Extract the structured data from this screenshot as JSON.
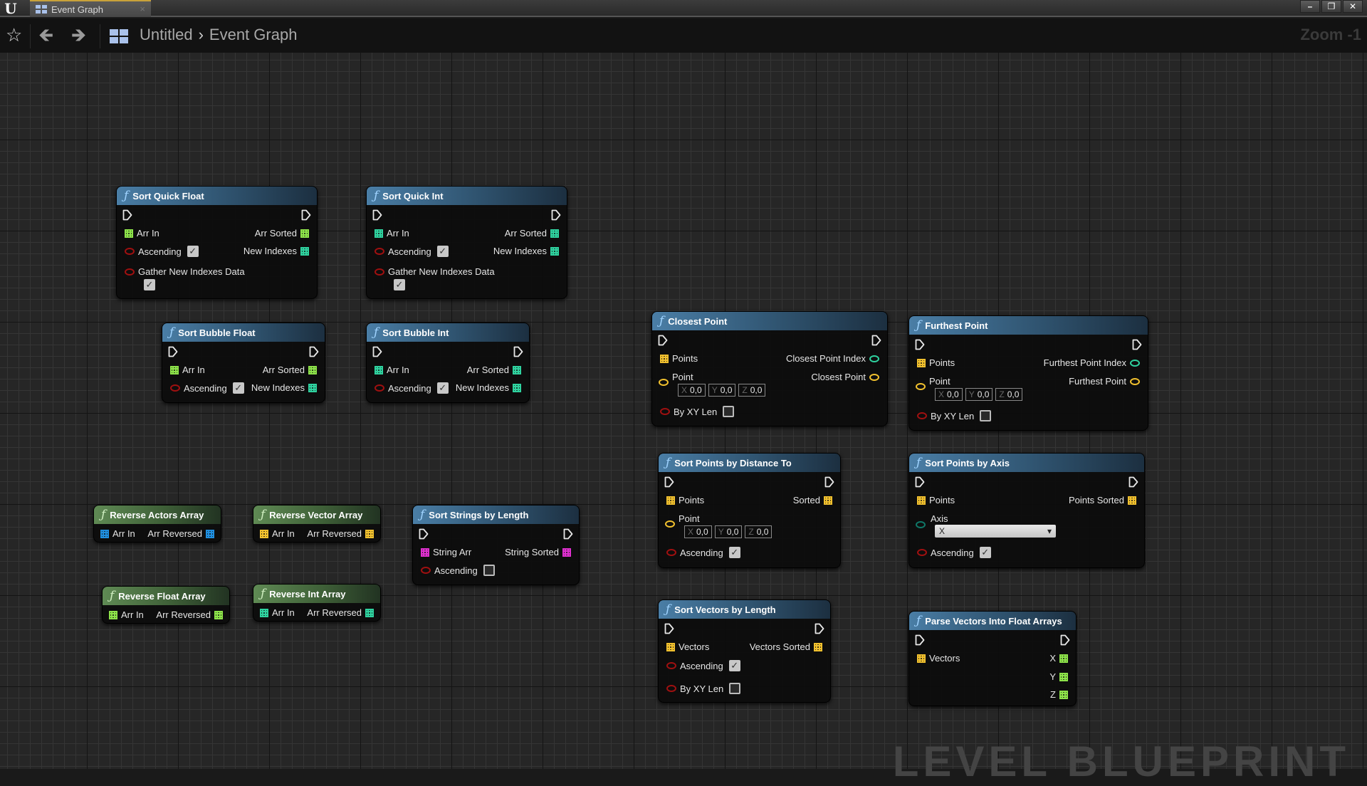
{
  "app": {
    "tab_title": "Event Graph",
    "breadcrumb": [
      "Untitled",
      "Event Graph"
    ],
    "zoom_label": "Zoom -1",
    "watermark": "LEVEL BLUEPRINT"
  },
  "colors": {
    "float_pin": "#8ee44a",
    "int_pin": "#2fd3a0",
    "vector_pin": "#f2c12e",
    "object_pin": "#1f8fe0",
    "string_pin": "#e030d0",
    "bool_pin": "#a01010",
    "enum_pin": "#0f7868"
  },
  "nodes": {
    "sort_quick_float": {
      "title": "Sort Quick Float",
      "in_arr": "Arr In",
      "ascending": "Ascending",
      "ascending_checked": true,
      "gather": "Gather New Indexes Data",
      "gather_checked": true,
      "out_sorted": "Arr Sorted",
      "out_indexes": "New Indexes"
    },
    "sort_quick_int": {
      "title": "Sort Quick Int",
      "in_arr": "Arr In",
      "ascending": "Ascending",
      "ascending_checked": true,
      "gather": "Gather New Indexes Data",
      "gather_checked": true,
      "out_sorted": "Arr Sorted",
      "out_indexes": "New Indexes"
    },
    "sort_bubble_float": {
      "title": "Sort Bubble Float",
      "in_arr": "Arr In",
      "ascending": "Ascending",
      "ascending_checked": true,
      "out_sorted": "Arr Sorted",
      "out_indexes": "New Indexes"
    },
    "sort_bubble_int": {
      "title": "Sort Bubble Int",
      "in_arr": "Arr In",
      "ascending": "Ascending",
      "ascending_checked": true,
      "out_sorted": "Arr Sorted",
      "out_indexes": "New Indexes"
    },
    "closest_point": {
      "title": "Closest Point",
      "points": "Points",
      "point": "Point",
      "x": "0,0",
      "y": "0,0",
      "z": "0,0",
      "by_xy_len": "By XY Len",
      "by_xy_checked": false,
      "out_index": "Closest Point Index",
      "out_point": "Closest Point"
    },
    "furthest_point": {
      "title": "Furthest Point",
      "points": "Points",
      "point": "Point",
      "x": "0,0",
      "y": "0,0",
      "z": "0,0",
      "by_xy_len": "By XY Len",
      "by_xy_checked": false,
      "out_index": "Furthest Point Index",
      "out_point": "Furthest Point"
    },
    "sort_points_distance": {
      "title": "Sort Points by Distance To",
      "points": "Points",
      "point": "Point",
      "x": "0,0",
      "y": "0,0",
      "z": "0,0",
      "ascending": "Ascending",
      "ascending_checked": true,
      "out_sorted": "Sorted"
    },
    "sort_points_axis": {
      "title": "Sort Points by Axis",
      "points": "Points",
      "axis": "Axis",
      "axis_value": "X",
      "ascending": "Ascending",
      "ascending_checked": true,
      "out_sorted": "Points Sorted"
    },
    "reverse_actors": {
      "title": "Reverse Actors Array",
      "in_arr": "Arr In",
      "out": "Arr Reversed"
    },
    "reverse_vector": {
      "title": "Reverse Vector Array",
      "in_arr": "Arr In",
      "out": "Arr Reversed"
    },
    "reverse_float": {
      "title": "Reverse Float Array",
      "in_arr": "Arr In",
      "out": "Arr Reversed"
    },
    "reverse_int": {
      "title": "Reverse Int Array",
      "in_arr": "Arr In",
      "out": "Arr Reversed"
    },
    "sort_strings": {
      "title": "Sort Strings by Length",
      "in_arr": "String Arr",
      "ascending": "Ascending",
      "ascending_checked": false,
      "out_sorted": "String Sorted"
    },
    "sort_vectors": {
      "title": "Sort Vectors by Length",
      "vectors": "Vectors",
      "ascending": "Ascending",
      "ascending_checked": true,
      "by_xy_len": "By XY Len",
      "by_xy_checked": false,
      "out_sorted": "Vectors Sorted"
    },
    "parse_vectors": {
      "title": "Parse Vectors Into Float Arrays",
      "vectors": "Vectors",
      "out_x": "X",
      "out_y": "Y",
      "out_z": "Z"
    }
  }
}
